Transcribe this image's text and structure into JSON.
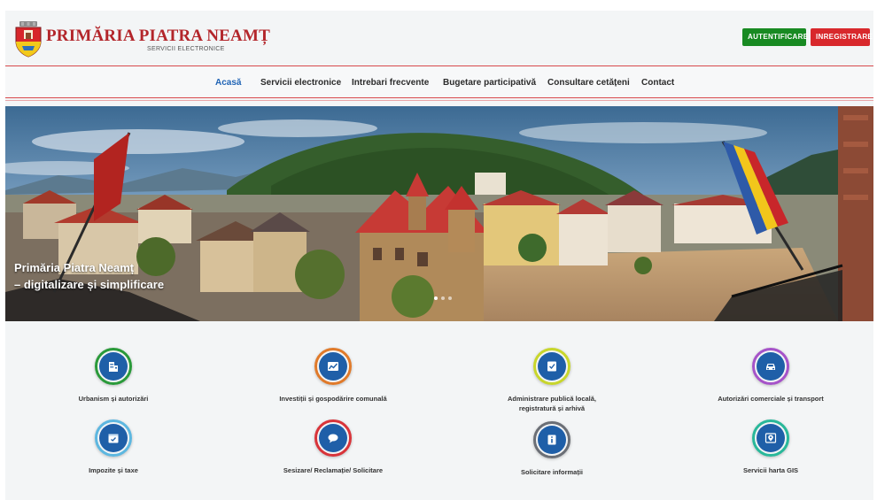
{
  "header": {
    "title": "PRIMĂRIA PIATRA NEAMȚ",
    "subtitle": "SERVICII ELECTRONICE",
    "login_label": "AUTENTIFICARE",
    "register_label": "INREGISTRARE"
  },
  "nav": {
    "items": [
      {
        "label": "Acasă"
      },
      {
        "label": "Servicii electronice"
      },
      {
        "label": "Intrebari frecvente"
      },
      {
        "label": "Bugetare participativă"
      },
      {
        "label": "Consultare cetățeni"
      },
      {
        "label": "Contact"
      }
    ]
  },
  "hero": {
    "title": "Primăria Piatra Neamț",
    "subtitle": "– digitalizare și simplificare",
    "slide_count": 3,
    "active_slide": 1
  },
  "services": [
    {
      "label": "Urbanism și autorizări",
      "icon": "building-icon",
      "ring": "#2a9a3a",
      "fill": "#1f5fa8"
    },
    {
      "label": "Investiții și gospodărire comunală",
      "icon": "chart-icon",
      "ring": "#e07a2a",
      "fill": "#1f5fa8"
    },
    {
      "label": "Administrare publică locală,",
      "label2": "registratură și arhivă",
      "icon": "document-icon",
      "ring": "#c8d62c",
      "fill": "#1f5fa8"
    },
    {
      "label": "Autorizări comerciale și transport",
      "icon": "car-icon",
      "ring": "#a653c9",
      "fill": "#1f5fa8"
    },
    {
      "label": "Impozite și taxe",
      "icon": "calendar-icon",
      "ring": "#5db7e0",
      "fill": "#1f5fa8"
    },
    {
      "label": "Sesizare/ Reclamație/ Solicitare",
      "icon": "chat-icon",
      "ring": "#d8343a",
      "fill": "#1f5fa8"
    },
    {
      "label": "Solicitare informații",
      "icon": "info-icon",
      "ring": "#6b6f76",
      "fill": "#1f5fa8"
    },
    {
      "label": "Servicii harta GIS",
      "icon": "map-pin-icon",
      "ring": "#29b89a",
      "fill": "#1f5fa8"
    }
  ],
  "colors": {
    "brand_red": "#b3262b",
    "nav_active": "#1f63b4",
    "login_green": "#188a22",
    "register_red": "#d8282c"
  }
}
